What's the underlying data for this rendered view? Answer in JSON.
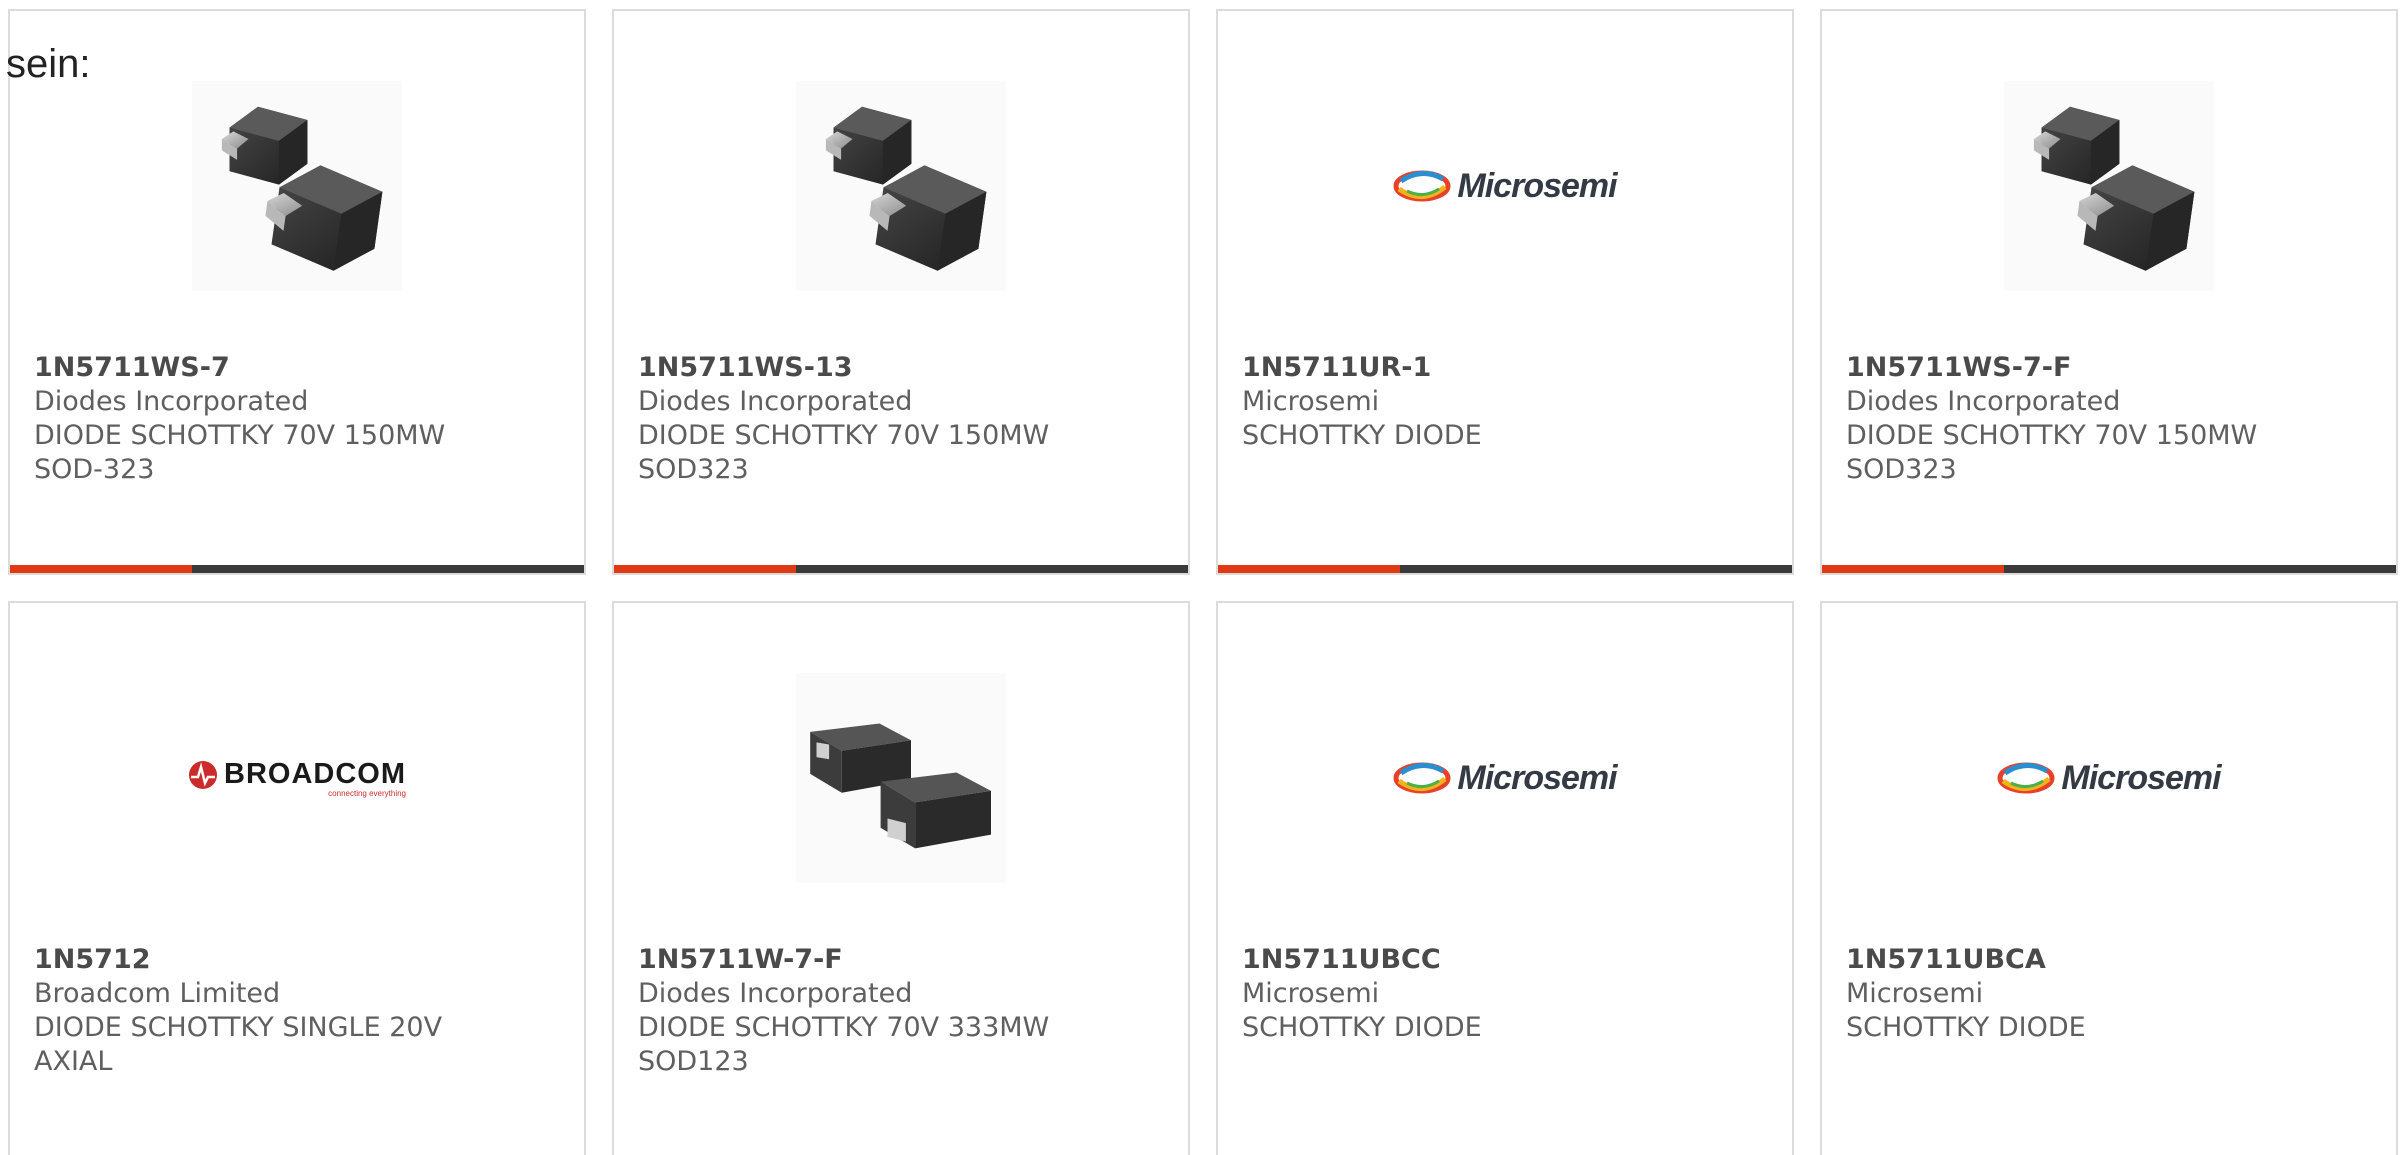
{
  "intro_text": "sein:",
  "colors": {
    "accent": "#e03a14",
    "bar": "#3a3a3a",
    "border": "#dcdcdc",
    "microsemi_text": "#333a44",
    "broadcom_red": "#cc2b2b"
  },
  "products": [
    {
      "part_number": "1N5711WS-7",
      "manufacturer": "Diodes Incorporated",
      "description_line1": "DIODE SCHOTTKY 70V 150MW",
      "description_line2": "SOD-323",
      "image": "sod323-diode-photo"
    },
    {
      "part_number": "1N5711WS-13",
      "manufacturer": "Diodes Incorporated",
      "description_line1": "DIODE SCHOTTKY 70V 150MW",
      "description_line2": "SOD323",
      "image": "sod323-diode-photo"
    },
    {
      "part_number": "1N5711UR-1",
      "manufacturer": "Microsemi",
      "description_line1": "SCHOTTKY DIODE",
      "description_line2": "",
      "image": "microsemi-logo",
      "logo_text": "Microsemi"
    },
    {
      "part_number": "1N5711WS-7-F",
      "manufacturer": "Diodes Incorporated",
      "description_line1": "DIODE SCHOTTKY 70V 150MW",
      "description_line2": "SOD323",
      "image": "sod323-diode-photo"
    },
    {
      "part_number": "1N5712",
      "manufacturer": "Broadcom Limited",
      "description_line1": "DIODE SCHOTTKY SINGLE 20V",
      "description_line2": "AXIAL",
      "image": "broadcom-logo",
      "logo_text": "BROADCOM",
      "logo_tagline": "connecting everything"
    },
    {
      "part_number": "1N5711W-7-F",
      "manufacturer": "Diodes Incorporated",
      "description_line1": "DIODE SCHOTTKY 70V 333MW",
      "description_line2": "SOD123",
      "image": "sod123-diode-photo"
    },
    {
      "part_number": "1N5711UBCC",
      "manufacturer": "Microsemi",
      "description_line1": "SCHOTTKY DIODE",
      "description_line2": "",
      "image": "microsemi-logo",
      "logo_text": "Microsemi"
    },
    {
      "part_number": "1N5711UBCA",
      "manufacturer": "Microsemi",
      "description_line1": "SCHOTTKY DIODE",
      "description_line2": "",
      "image": "microsemi-logo",
      "logo_text": "Microsemi"
    }
  ]
}
